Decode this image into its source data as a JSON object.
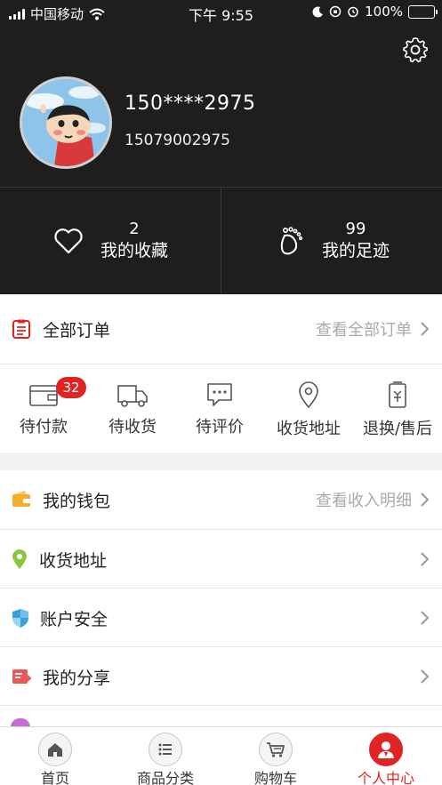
{
  "status_bar": {
    "carrier": "中国移动",
    "time": "下午 9:55",
    "battery": "100%"
  },
  "profile": {
    "nickname": "150****2975",
    "phone": "15079002975"
  },
  "stats": [
    {
      "count": "2",
      "label": "我的收藏",
      "icon": "heart-icon"
    },
    {
      "count": "99",
      "label": "我的足迹",
      "icon": "footprint-icon"
    }
  ],
  "orders": {
    "title": "全部订单",
    "view_all": "查看全部订单",
    "items": [
      {
        "label": "待付款",
        "icon": "wallet-icon",
        "badge": "32"
      },
      {
        "label": "待收货",
        "icon": "truck-icon"
      },
      {
        "label": "待评价",
        "icon": "comment-icon"
      },
      {
        "label": "收货地址",
        "icon": "location-icon"
      },
      {
        "label": "退换/售后",
        "icon": "refund-icon"
      }
    ]
  },
  "menu": [
    {
      "label": "我的钱包",
      "hint": "查看收入明细",
      "icon": "wallet-icon",
      "color": "#f2b12c"
    },
    {
      "label": "收货地址",
      "hint": "",
      "icon": "location-icon",
      "color": "#8cc63f"
    },
    {
      "label": "账户安全",
      "hint": "",
      "icon": "shield-icon",
      "color": "#3aa0d8"
    },
    {
      "label": "我的分享",
      "hint": "",
      "icon": "share-icon",
      "color": "#e85a5a"
    }
  ],
  "tabs": [
    {
      "label": "首页",
      "icon": "home-icon",
      "active": false
    },
    {
      "label": "商品分类",
      "icon": "list-icon",
      "active": false
    },
    {
      "label": "购物车",
      "icon": "cart-icon",
      "active": false
    },
    {
      "label": "个人中心",
      "icon": "user-icon",
      "active": true
    }
  ],
  "colors": {
    "accent": "#e02424",
    "header_bg": "#1e1e1e"
  }
}
